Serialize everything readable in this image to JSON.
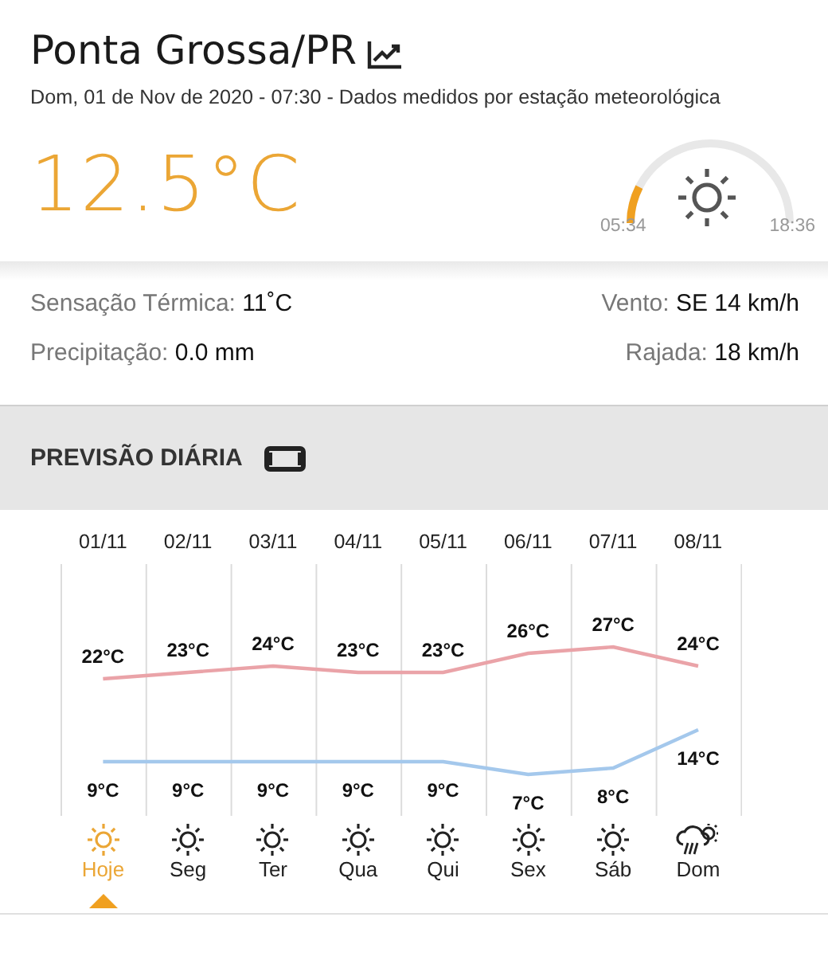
{
  "city": {
    "title": "Ponta Grossa/PR"
  },
  "subtitle": "Dom, 01 de Nov de 2020 - 07:30 - Dados medidos por estação meteorológica",
  "current": {
    "temperature": "12.5°C"
  },
  "sun": {
    "sunrise": "05:34",
    "sunset": "18:36"
  },
  "details": [
    {
      "label": "Sensação Térmica:",
      "value": "11˚C"
    },
    {
      "label": "Vento:",
      "value": "SE 14 km/h"
    },
    {
      "label": "Precipitação:",
      "value": "0.0 mm"
    },
    {
      "label": "Rajada:",
      "value": "18 km/h"
    }
  ],
  "forecast": {
    "title": "PREVISÃO DIÁRIA",
    "chart_data": {
      "type": "line",
      "categories": [
        "01/11",
        "02/11",
        "03/11",
        "04/11",
        "05/11",
        "06/11",
        "07/11",
        "08/11"
      ],
      "data_labels": true,
      "series": [
        {
          "color": "#eaa3a8",
          "values": [
            22,
            23,
            24,
            23,
            23,
            26,
            27,
            24
          ],
          "value_labels": [
            "22°C",
            "23°C",
            "24°C",
            "23°C",
            "23°C",
            "26°C",
            "27°C",
            "24°C"
          ]
        },
        {
          "color": "#a4c8ec",
          "values": [
            9,
            9,
            9,
            9,
            9,
            7,
            8,
            14
          ],
          "value_labels": [
            "9°C",
            "9°C",
            "9°C",
            "9°C",
            "9°C",
            "7°C",
            "8°C",
            "14°C"
          ]
        }
      ]
    },
    "days": [
      {
        "label": "Hoje",
        "kind": "sunny",
        "selected": true
      },
      {
        "label": "Seg",
        "kind": "sunny",
        "selected": false
      },
      {
        "label": "Ter",
        "kind": "sunny",
        "selected": false
      },
      {
        "label": "Qua",
        "kind": "sunny",
        "selected": false
      },
      {
        "label": "Qui",
        "kind": "sunny",
        "selected": false
      },
      {
        "label": "Sex",
        "kind": "sunny",
        "selected": false
      },
      {
        "label": "Sáb",
        "kind": "sunny",
        "selected": false
      },
      {
        "label": "Dom",
        "kind": "showers",
        "selected": false
      }
    ]
  }
}
